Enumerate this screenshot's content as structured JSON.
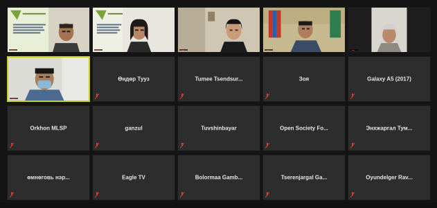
{
  "meeting": {
    "participants": [
      {
        "name": "",
        "has_video": true,
        "video_type": "slide-person-man"
      },
      {
        "name": "",
        "has_video": true,
        "video_type": "slide-person-woman"
      },
      {
        "name": "",
        "has_video": true,
        "video_type": "room-woman"
      },
      {
        "name": "",
        "has_video": true,
        "video_type": "office-man-flag"
      },
      {
        "name": "",
        "has_video": true,
        "video_type": "room-person-headscarf"
      },
      {
        "name": "",
        "has_video": true,
        "video_type": "man-mask",
        "active_speaker": true
      },
      {
        "name": "Өндөр Тууз",
        "has_video": false
      },
      {
        "name": "Tumee  Tsendsur...",
        "has_video": false
      },
      {
        "name": "Зоя",
        "has_video": false
      },
      {
        "name": "Galaxy A5 (2017)",
        "has_video": false
      },
      {
        "name": "Orkhon MLSP",
        "has_video": false
      },
      {
        "name": "ganzul",
        "has_video": false
      },
      {
        "name": "Tuvshinbayar",
        "has_video": false
      },
      {
        "name": "Open Society Fo...",
        "has_video": false
      },
      {
        "name": "Энхжаргал Тум...",
        "has_video": false
      },
      {
        "name": "өмнөговь нэр...",
        "has_video": false
      },
      {
        "name": "Eagle TV",
        "has_video": false
      },
      {
        "name": "Bolormaa  Gamb...",
        "has_video": false
      },
      {
        "name": "Tserenjargal  Ga...",
        "has_video": false
      },
      {
        "name": "Oyundelger  Rav...",
        "has_video": false
      }
    ]
  },
  "colors": {
    "active_border": "#c9d21a",
    "muted_mic": "#d23b3b",
    "tile_bg": "#2d2d2d",
    "page_bg": "#141414"
  }
}
